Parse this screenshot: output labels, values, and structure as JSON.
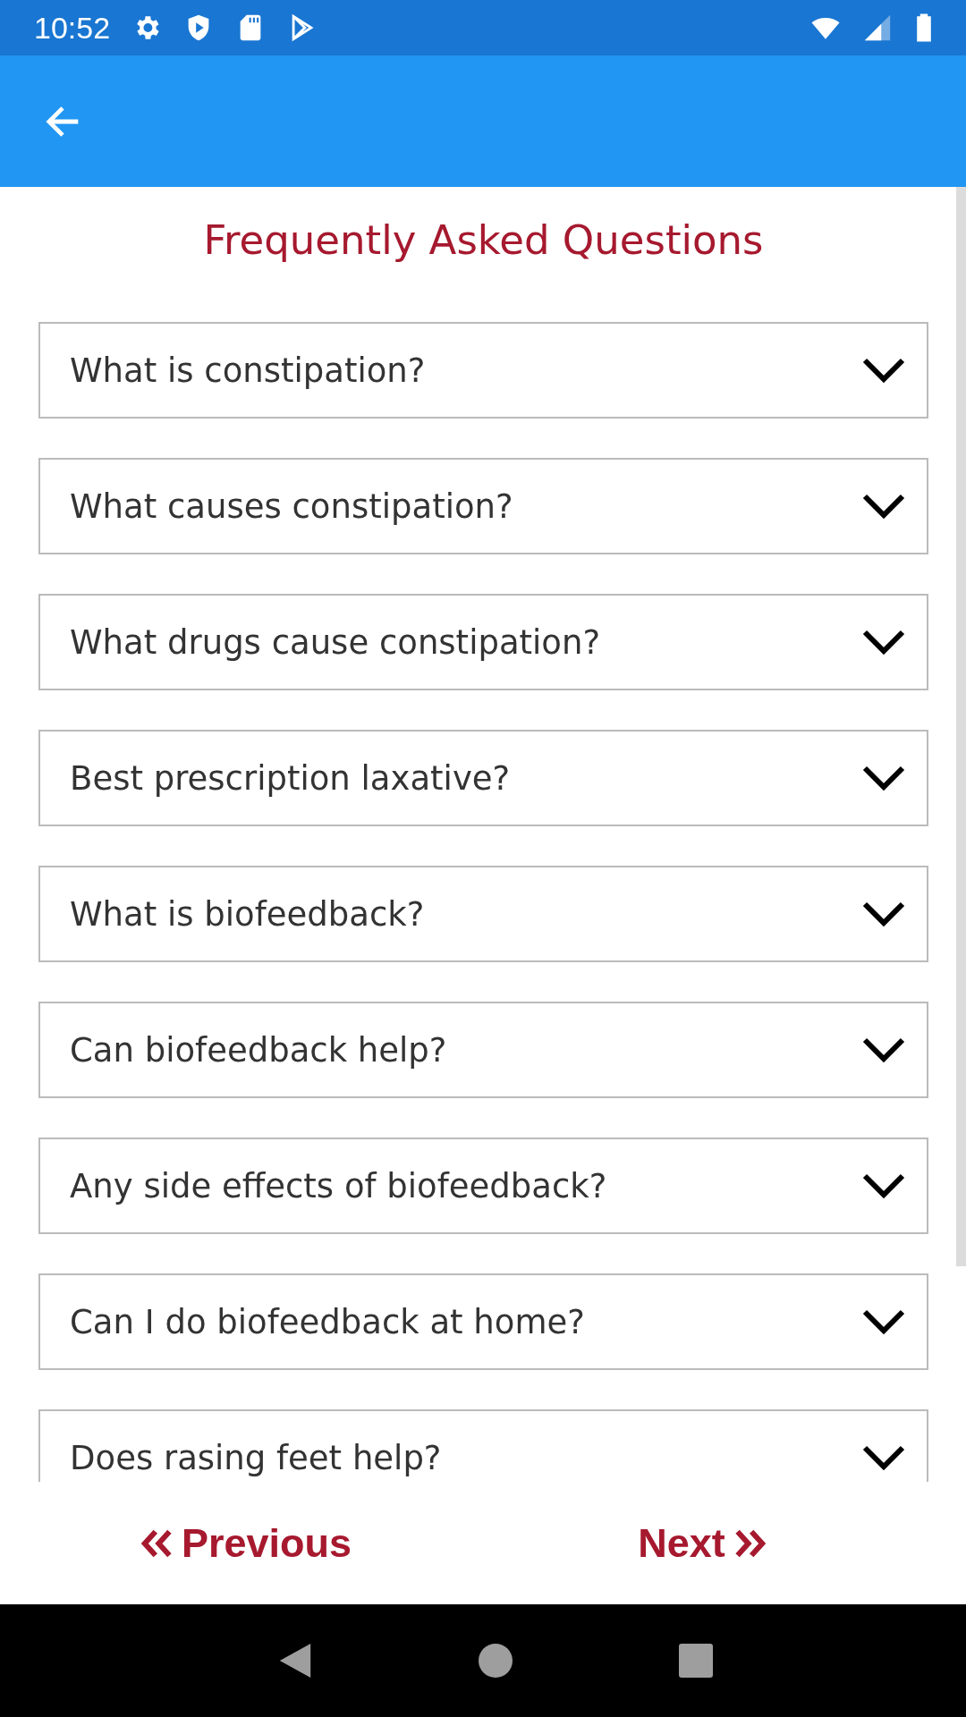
{
  "status_bar": {
    "time": "10:52"
  },
  "title": "Frequently Asked Questions",
  "questions": [
    {
      "text": "What is constipation?",
      "expanded": false
    },
    {
      "text": "What causes constipation?",
      "expanded": false
    },
    {
      "text": "What drugs cause constipation?",
      "expanded": false
    },
    {
      "text": "Best prescription laxative?",
      "expanded": false
    },
    {
      "text": "What is biofeedback?",
      "expanded": false
    },
    {
      "text": "Can biofeedback help?",
      "expanded": false
    },
    {
      "text": "Any side effects of biofeedback?",
      "expanded": false
    },
    {
      "text": "Can I do biofeedback at home?",
      "expanded": false
    },
    {
      "text": "Does rasing feet help?",
      "expanded": false
    }
  ],
  "footer": {
    "previous": "Previous",
    "next": "Next"
  }
}
